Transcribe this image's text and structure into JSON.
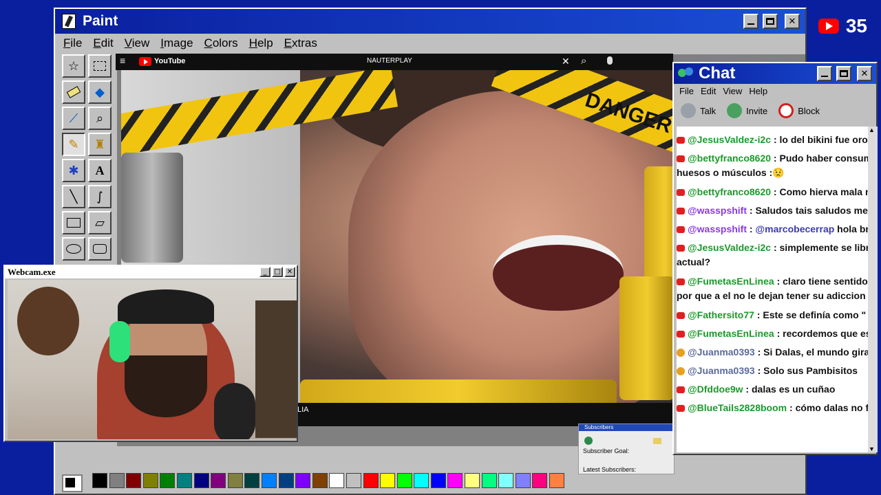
{
  "paint": {
    "title": "Paint",
    "menus": [
      "File",
      "Edit",
      "View",
      "Image",
      "Colors",
      "Help",
      "Extras"
    ],
    "tools": [
      "free-select",
      "rect-select",
      "eraser",
      "fill",
      "color-picker",
      "magnifier",
      "pencil",
      "brush",
      "airbrush",
      "text",
      "line",
      "curve",
      "rectangle",
      "polygon",
      "ellipse",
      "rounded-rect"
    ],
    "palette": [
      "#000000",
      "#808080",
      "#800000",
      "#808000",
      "#008000",
      "#008080",
      "#000080",
      "#800080",
      "#808040",
      "#004040",
      "#0080ff",
      "#004080",
      "#8000ff",
      "#804000",
      "#ffffff",
      "#c0c0c0",
      "#ff0000",
      "#ffff00",
      "#00ff00",
      "#00ffff",
      "#0000ff",
      "#ff00ff",
      "#ffff80",
      "#00ff80",
      "#80ffff",
      "#8080ff",
      "#ff0080",
      "#ff8040"
    ]
  },
  "browser": {
    "site": "YouTube",
    "search_text": "NAUTERPLAY",
    "footer_text": "LIA"
  },
  "video": {
    "sign_text": "DANGER"
  },
  "webcam": {
    "title": "Webcam.exe"
  },
  "chat": {
    "title": "Chat",
    "menus": [
      "File",
      "Edit",
      "View",
      "Help"
    ],
    "tools": [
      {
        "label": "Talk",
        "icon": "talk-icon"
      },
      {
        "label": "Invite",
        "icon": "invite-icon"
      },
      {
        "label": "Block",
        "icon": "block-icon"
      }
    ],
    "messages": [
      {
        "user": "@JesusValdez-i2c",
        "sep": " : ",
        "text": "lo del bikini fue oro",
        "badge": "red",
        "color": "green"
      },
      {
        "user": "@bettyfranco8620",
        "sep": " : ",
        "text": "Pudo haber consumido",
        "cont": "huesos o músculos :😟",
        "badge": "red",
        "color": "green"
      },
      {
        "user": "@bettyfranco8620",
        "sep": " : ",
        "text": "Como hierva mala nunc",
        "badge": "red",
        "color": "green"
      },
      {
        "user": "@wasspshift",
        "sep": " : ",
        "text": "Saludos tais saludos mexi",
        "badge": "red",
        "color": "purple"
      },
      {
        "user": "@wasspshift",
        "sep": " : ",
        "mention": "@marcobecerrap",
        "text": " hola bro",
        "badge": "red",
        "color": "purple"
      },
      {
        "user": "@JesusValdez-i2c",
        "sep": " : ",
        "text": "simplemente se libra po",
        "cont": "actual?",
        "badge": "red",
        "color": "green"
      },
      {
        "user": "@FumetasEnLinea",
        "sep": " : ",
        "text": "claro tiene sentido, esta",
        "cont": "por que a el no le dejan tener su adiccion",
        "badge": "red",
        "color": "green"
      },
      {
        "user": "@Fathersito77",
        "sep": " : ",
        "text": "Este se definía como \" el de",
        "badge": "red",
        "color": "green"
      },
      {
        "user": "@FumetasEnLinea",
        "sep": " : ",
        "text": "recordemos que es exp",
        "badge": "red",
        "color": "green"
      },
      {
        "user": "@Juanma0393",
        "sep": " : ",
        "text": "Si Dalas, el mundo gira s",
        "badge": "star",
        "color": "gray"
      },
      {
        "user": "@Juanma0393",
        "sep": " : ",
        "text": "Solo sus Pambisitos",
        "badge": "star",
        "color": "gray"
      },
      {
        "user": "@Dfddoe9w",
        "sep": " : ",
        "text": "dalas es un cuñao",
        "badge": "red",
        "color": "green"
      },
      {
        "user": "@BlueTails2828boom",
        "sep": " : ",
        "text": "cómo dalas no fue a",
        "badge": "red",
        "color": "green"
      }
    ]
  },
  "subscribers": {
    "header": "Subscribers",
    "goal_label": "Subscriber Goal:",
    "latest_label": "Latest Subscribers:"
  },
  "youtube_counter": {
    "count": "35"
  }
}
